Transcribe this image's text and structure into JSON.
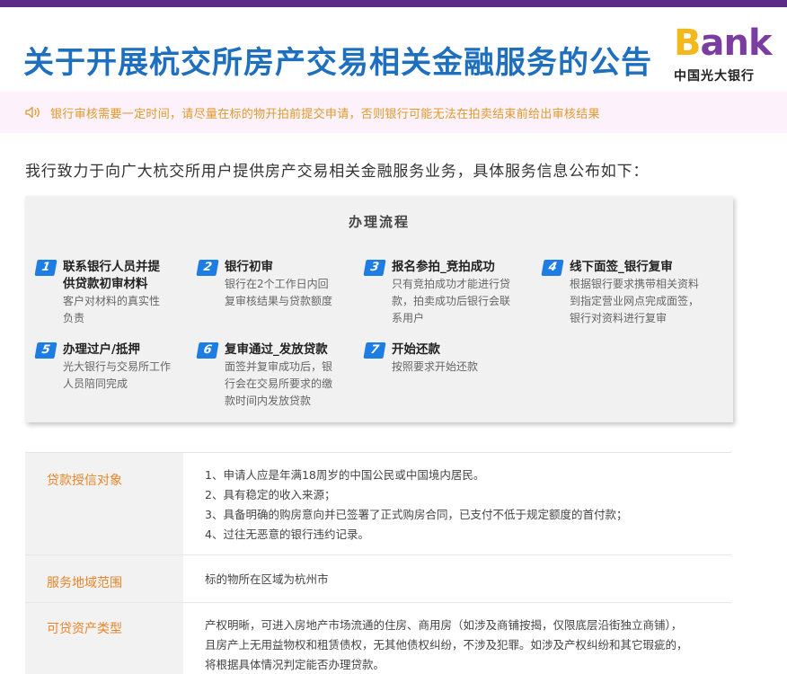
{
  "header": {
    "title": "关于开展杭交所房产交易相关金融服务的公告",
    "logo_b": "B",
    "logo_rest": "ank",
    "logo_sub": "中国光大银行"
  },
  "notice": {
    "icon": "speaker-icon",
    "text": "银行审核需要一定时间，请尽量在标的物开拍前提交申请，否则银行可能无法在拍卖结束前给出审核结果"
  },
  "intro": "我行致力于向广大杭交所用户提供房产交易相关金融服务业务，具体服务信息公布如下：",
  "flow": {
    "title": "办理流程",
    "steps": [
      {
        "num": "1",
        "title_lines": [
          "联系银行人员并提",
          "供贷款初审材料"
        ],
        "desc_lines": [
          "客户对材料的真实性",
          "负责"
        ]
      },
      {
        "num": "2",
        "title_lines": [
          "银行初审"
        ],
        "desc_lines": [
          "银行在2个工作日内回",
          "复审核结果与贷款额度"
        ]
      },
      {
        "num": "3",
        "title_lines": [
          "报名参拍_竞拍成功"
        ],
        "desc_lines": [
          "只有竞拍成功才能进行贷",
          "款，拍卖成功后银行会联",
          "系用户"
        ]
      },
      {
        "num": "4",
        "title_lines": [
          "线下面签_银行复审"
        ],
        "desc_lines": [
          "根据银行要求携带相关资料",
          "到指定营业网点完成面签，",
          "银行对资料进行复审"
        ]
      },
      {
        "num": "5",
        "title_lines": [
          "办理过户/抵押"
        ],
        "desc_lines": [
          "光大银行与交易所工作",
          "人员陪同完成"
        ]
      },
      {
        "num": "6",
        "title_lines": [
          "复审通过_发放贷款"
        ],
        "desc_lines": [
          "面签并复审成功后，银",
          "行会在交易所要求的缴",
          "款时间内发放贷款"
        ]
      },
      {
        "num": "7",
        "title_lines": [
          "开始还款"
        ],
        "desc_lines": [
          "按照要求开始还款"
        ]
      }
    ]
  },
  "info": [
    {
      "label": "贷款授信对象",
      "lines": [
        "1、申请人应是年满18周岁的中国公民或中国境内居民。",
        "2、具有稳定的收入来源；",
        "3、具备明确的购房意向并已签署了正式购房合同，已支付不低于规定额度的首付款；",
        "4、过往无恶意的银行违约记录。"
      ]
    },
    {
      "label": "服务地域范围",
      "lines": [
        "标的物所在区域为杭州市"
      ]
    },
    {
      "label": "可贷资产类型",
      "lines": [
        "产权明晰，可进入房地产市场流通的住房、商用房（如涉及商铺按揭，仅限底层沿街独立商铺），",
        "且房产上无用益物权和租赁债权，无其他债权纠纷，不涉及犯罪。如涉及产权纠纷和其它瑕疵的，",
        "将根据具体情况判定能否办理贷款。"
      ]
    }
  ],
  "colors": {
    "brand_purple": "#5b2d86",
    "title_blue": "#1f6fbf",
    "step_blue": "#1e7de2",
    "accent_orange": "#e8852a",
    "notice_bg": "#fdf1fb"
  }
}
